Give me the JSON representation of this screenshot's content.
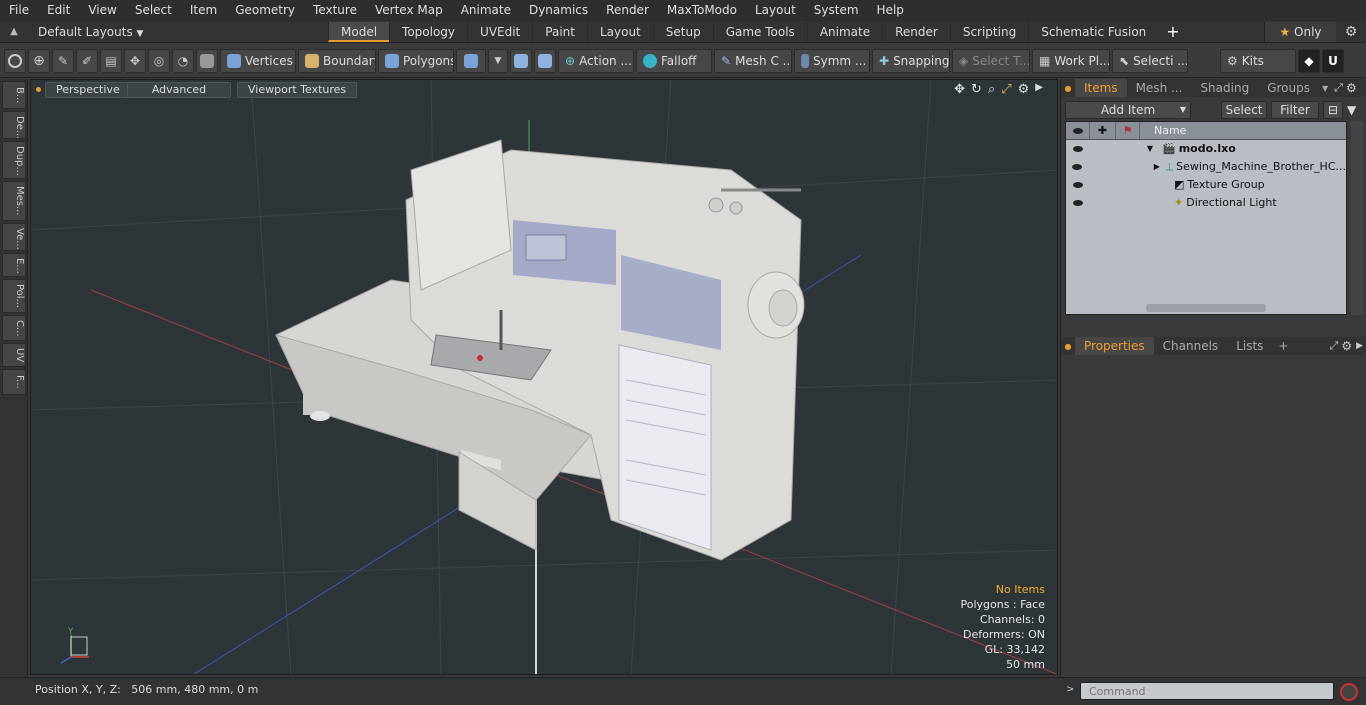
{
  "menubar": {
    "items": [
      "File",
      "Edit",
      "View",
      "Select",
      "Item",
      "Geometry",
      "Texture",
      "Vertex Map",
      "Animate",
      "Dynamics",
      "Render",
      "MaxToModo",
      "Layout",
      "System",
      "Help"
    ]
  },
  "layoutbar": {
    "layouts_label": "Default Layouts",
    "tabs": [
      "Model",
      "Topology",
      "UVEdit",
      "Paint",
      "Layout",
      "Setup",
      "Game Tools",
      "Animate",
      "Render",
      "Scripting",
      "Schematic Fusion"
    ],
    "active_tab": "Model",
    "add_label": "+",
    "only_label": "Only"
  },
  "toolbar": {
    "vertices": "Vertices",
    "boundary": "Boundary",
    "polygons": "Polygons",
    "action": "Action ...",
    "falloff": "Falloff",
    "mesh": "Mesh C ...",
    "symm": "Symm ...",
    "snapping": "Snapping",
    "select_t": "Select T...",
    "work_pl": "Work Pl...",
    "selecti": "Selecti ...",
    "kits": "Kits"
  },
  "lefttabs": [
    "B...",
    "De...",
    "Dup...",
    "Mes...",
    "Ve...",
    "E...",
    "Pol...",
    "C...",
    "UV",
    "F..."
  ],
  "viewport": {
    "view_mode": "Perspective",
    "shading": "Advanced",
    "textures": "Viewport Textures",
    "info": {
      "selection": "No Items",
      "polygons": "Polygons : Face",
      "channels": "Channels: 0",
      "deformers": "Deformers: ON",
      "gl": "GL: 33,142",
      "scale": "50 mm"
    }
  },
  "statusbar": {
    "position": "Position X, Y, Z:   506 mm, 480 mm, 0 m"
  },
  "items_panel": {
    "tabs": [
      "Items",
      "Mesh ...",
      "Shading",
      "Groups"
    ],
    "active_tab": "Items",
    "add_item": "Add Item",
    "select": "Select",
    "filter": "Filter",
    "column_name": "Name",
    "tree": [
      {
        "label": "modo.lxo",
        "level": 0,
        "bold": true
      },
      {
        "label": "Sewing_Machine_Brother_HC...",
        "level": 1
      },
      {
        "label": "Texture Group",
        "level": 1
      },
      {
        "label": "Directional Light",
        "level": 1
      }
    ]
  },
  "properties_panel": {
    "tabs": [
      "Properties",
      "Channels",
      "Lists"
    ],
    "active_tab": "Properties",
    "add_label": "+"
  },
  "command": {
    "placeholder": "Command"
  },
  "colors": {
    "accent": "#e49c2c",
    "viewport_bg": "#2e3538",
    "info_highlight": "#f0b030"
  }
}
